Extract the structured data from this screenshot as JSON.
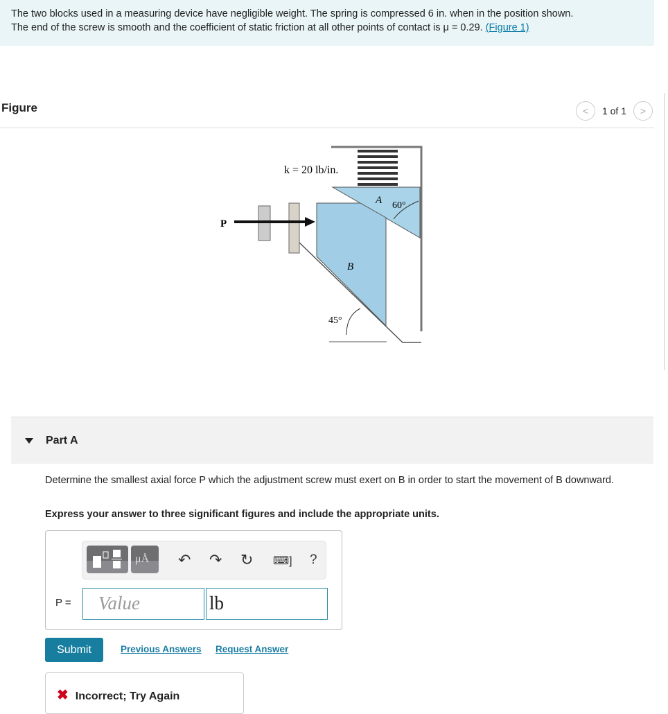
{
  "intro": {
    "line1": "The two blocks used in a measuring device have negligible weight. The spring is compressed 6 in. when in the position shown.",
    "line2": "The end of the screw is smooth and the coefficient of static friction at all other points of contact is μ = 0.29. ",
    "link": "(Figure 1)"
  },
  "figure": {
    "title": "Figure",
    "pager": "1 of 1",
    "prev_icon": "chevron-left-icon",
    "next_icon": "chevron-right-icon",
    "labels": {
      "k": "k = 20 lb/in.",
      "P": "P",
      "A": "A",
      "B": "B",
      "angle_a": "60°",
      "angle_b": "45°"
    }
  },
  "part": {
    "title": "Part A",
    "question": "Determine the smallest axial force P which the adjustment screw must exert on B in order to start the movement of B downward.",
    "instruction": "Express your answer to three significant figures and include the appropriate units."
  },
  "answer": {
    "label": "P =",
    "placeholder": "Value",
    "unit": "lb",
    "toolbar": {
      "units_label": "μÅ",
      "help": "?"
    }
  },
  "actions": {
    "submit": "Submit",
    "previous": "Previous Answers",
    "request": "Request Answer"
  },
  "feedback": {
    "text": "Incorrect; Try Again"
  }
}
